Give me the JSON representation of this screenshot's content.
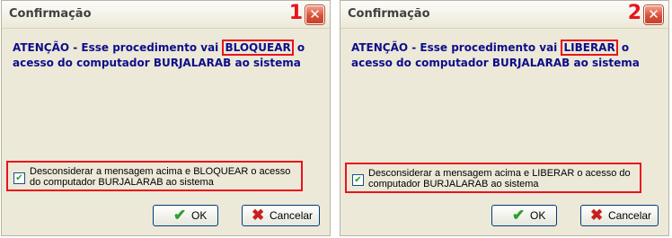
{
  "dialogs": [
    {
      "title": "Confirmação",
      "marker": "1",
      "close": "✕",
      "message_pre": "ATENÇÃO - Esse procedimento vai ",
      "message_highlight": "BLOQUEAR",
      "message_post": " o acesso do computador BURJALARAB ao sistema",
      "checkbox_checked": true,
      "checkbox_label": "Desconsiderar a mensagem acima e BLOQUEAR o acesso do computador BURJALARAB ao sistema",
      "ok_label": "OK",
      "cancel_label": "Cancelar"
    },
    {
      "title": "Confirmação",
      "marker": "2",
      "close": "✕",
      "message_pre": "ATENÇÃO - Esse procedimento vai ",
      "message_highlight": "LIBERAR",
      "message_post": " o acesso do computador BURJALARAB ao sistema",
      "checkbox_checked": true,
      "checkbox_label": "Desconsiderar a mensagem acima e LIBERAR o acesso do computador BURJALARAB ao sistema",
      "ok_label": "OK",
      "cancel_label": "Cancelar"
    }
  ],
  "icons": {
    "check_glyph": "✔",
    "ok_glyph": "✔",
    "cancel_glyph": "✖"
  },
  "colors": {
    "message_text": "#0e0e8a",
    "highlight_border": "#e8141c",
    "marker": "#e8141c",
    "dialog_bg": "#ece9d8"
  }
}
